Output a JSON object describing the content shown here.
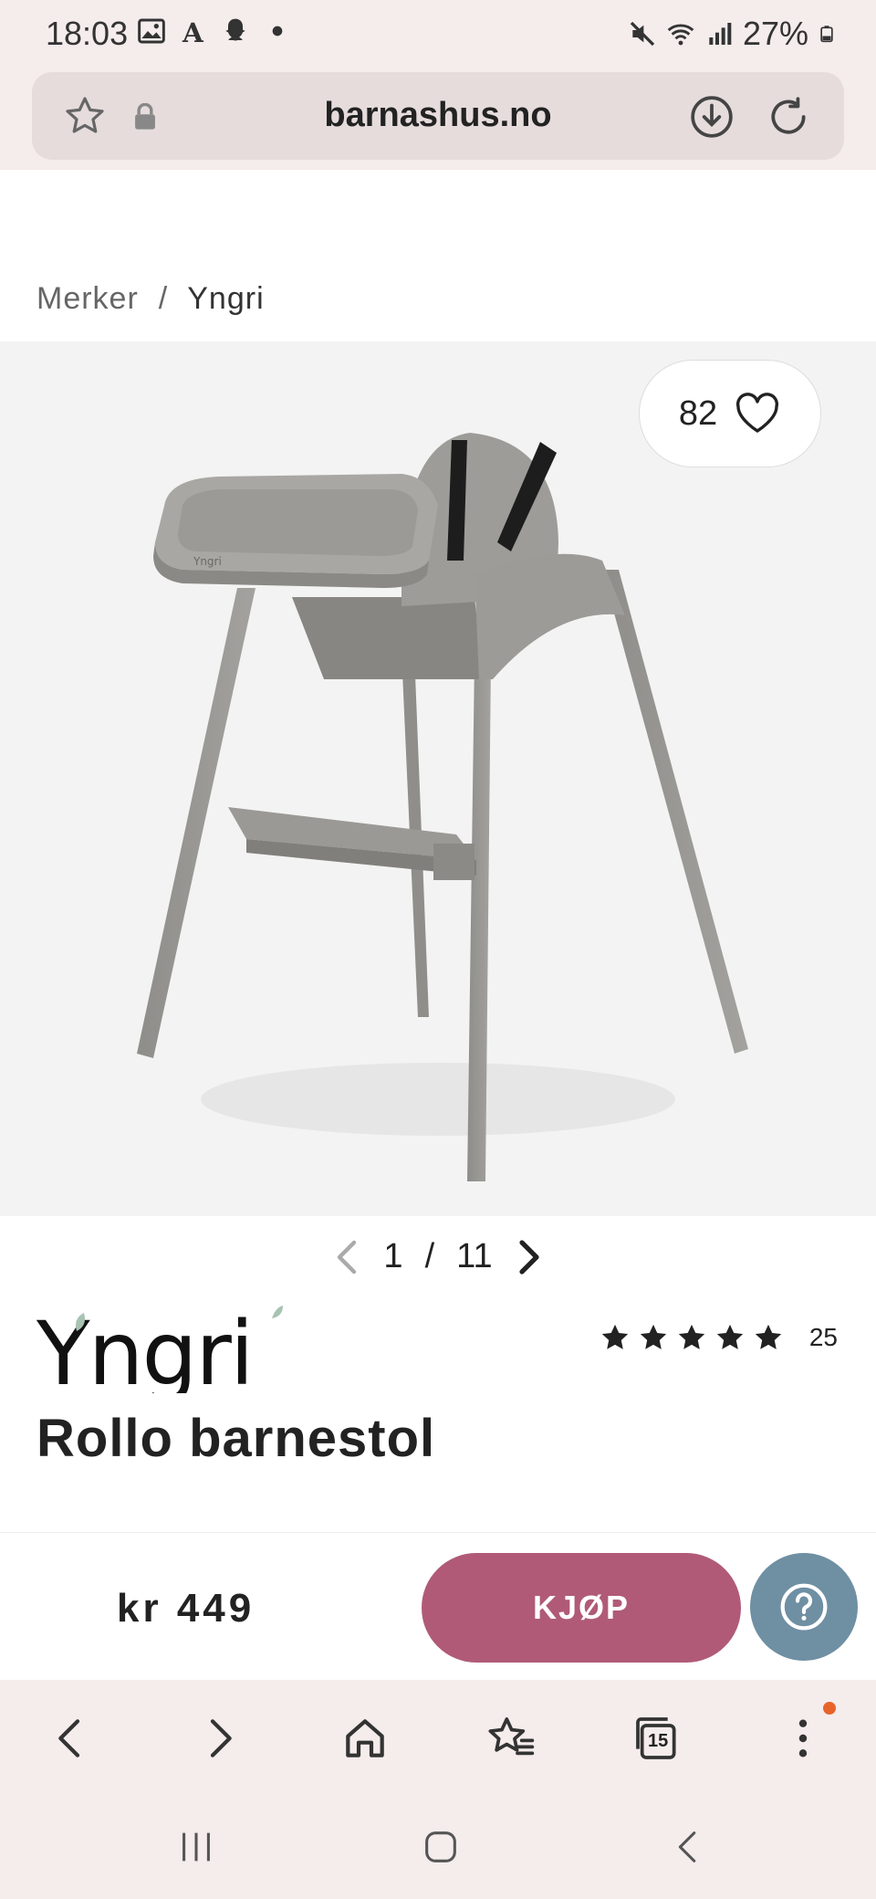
{
  "status_bar": {
    "time": "18:03",
    "battery": "27%",
    "icons": [
      "image-icon",
      "font-icon",
      "snapchat-icon",
      "dot-icon",
      "mute-icon",
      "wifi-icon",
      "signal-icon",
      "battery-icon"
    ]
  },
  "browser": {
    "url": "barnashus.no"
  },
  "breadcrumb": {
    "parent": "Merker",
    "separator": "/",
    "current": "Yngri"
  },
  "gallery": {
    "favorites_count": "82",
    "current_page": "1",
    "separator": "/",
    "total_pages": "11"
  },
  "product": {
    "brand": "Yngri",
    "name": "Rollo barnestol",
    "rating_stars": 5,
    "review_count": "25",
    "price": "kr 449"
  },
  "actions": {
    "buy_label": "KJØP"
  },
  "bottom_bar": {
    "tabs_count": "15"
  },
  "colors": {
    "buy_button": "#b05a78",
    "help_button": "#6f8fa3",
    "chrome_bg": "#f5ecec",
    "notification_dot": "#e8632a"
  }
}
